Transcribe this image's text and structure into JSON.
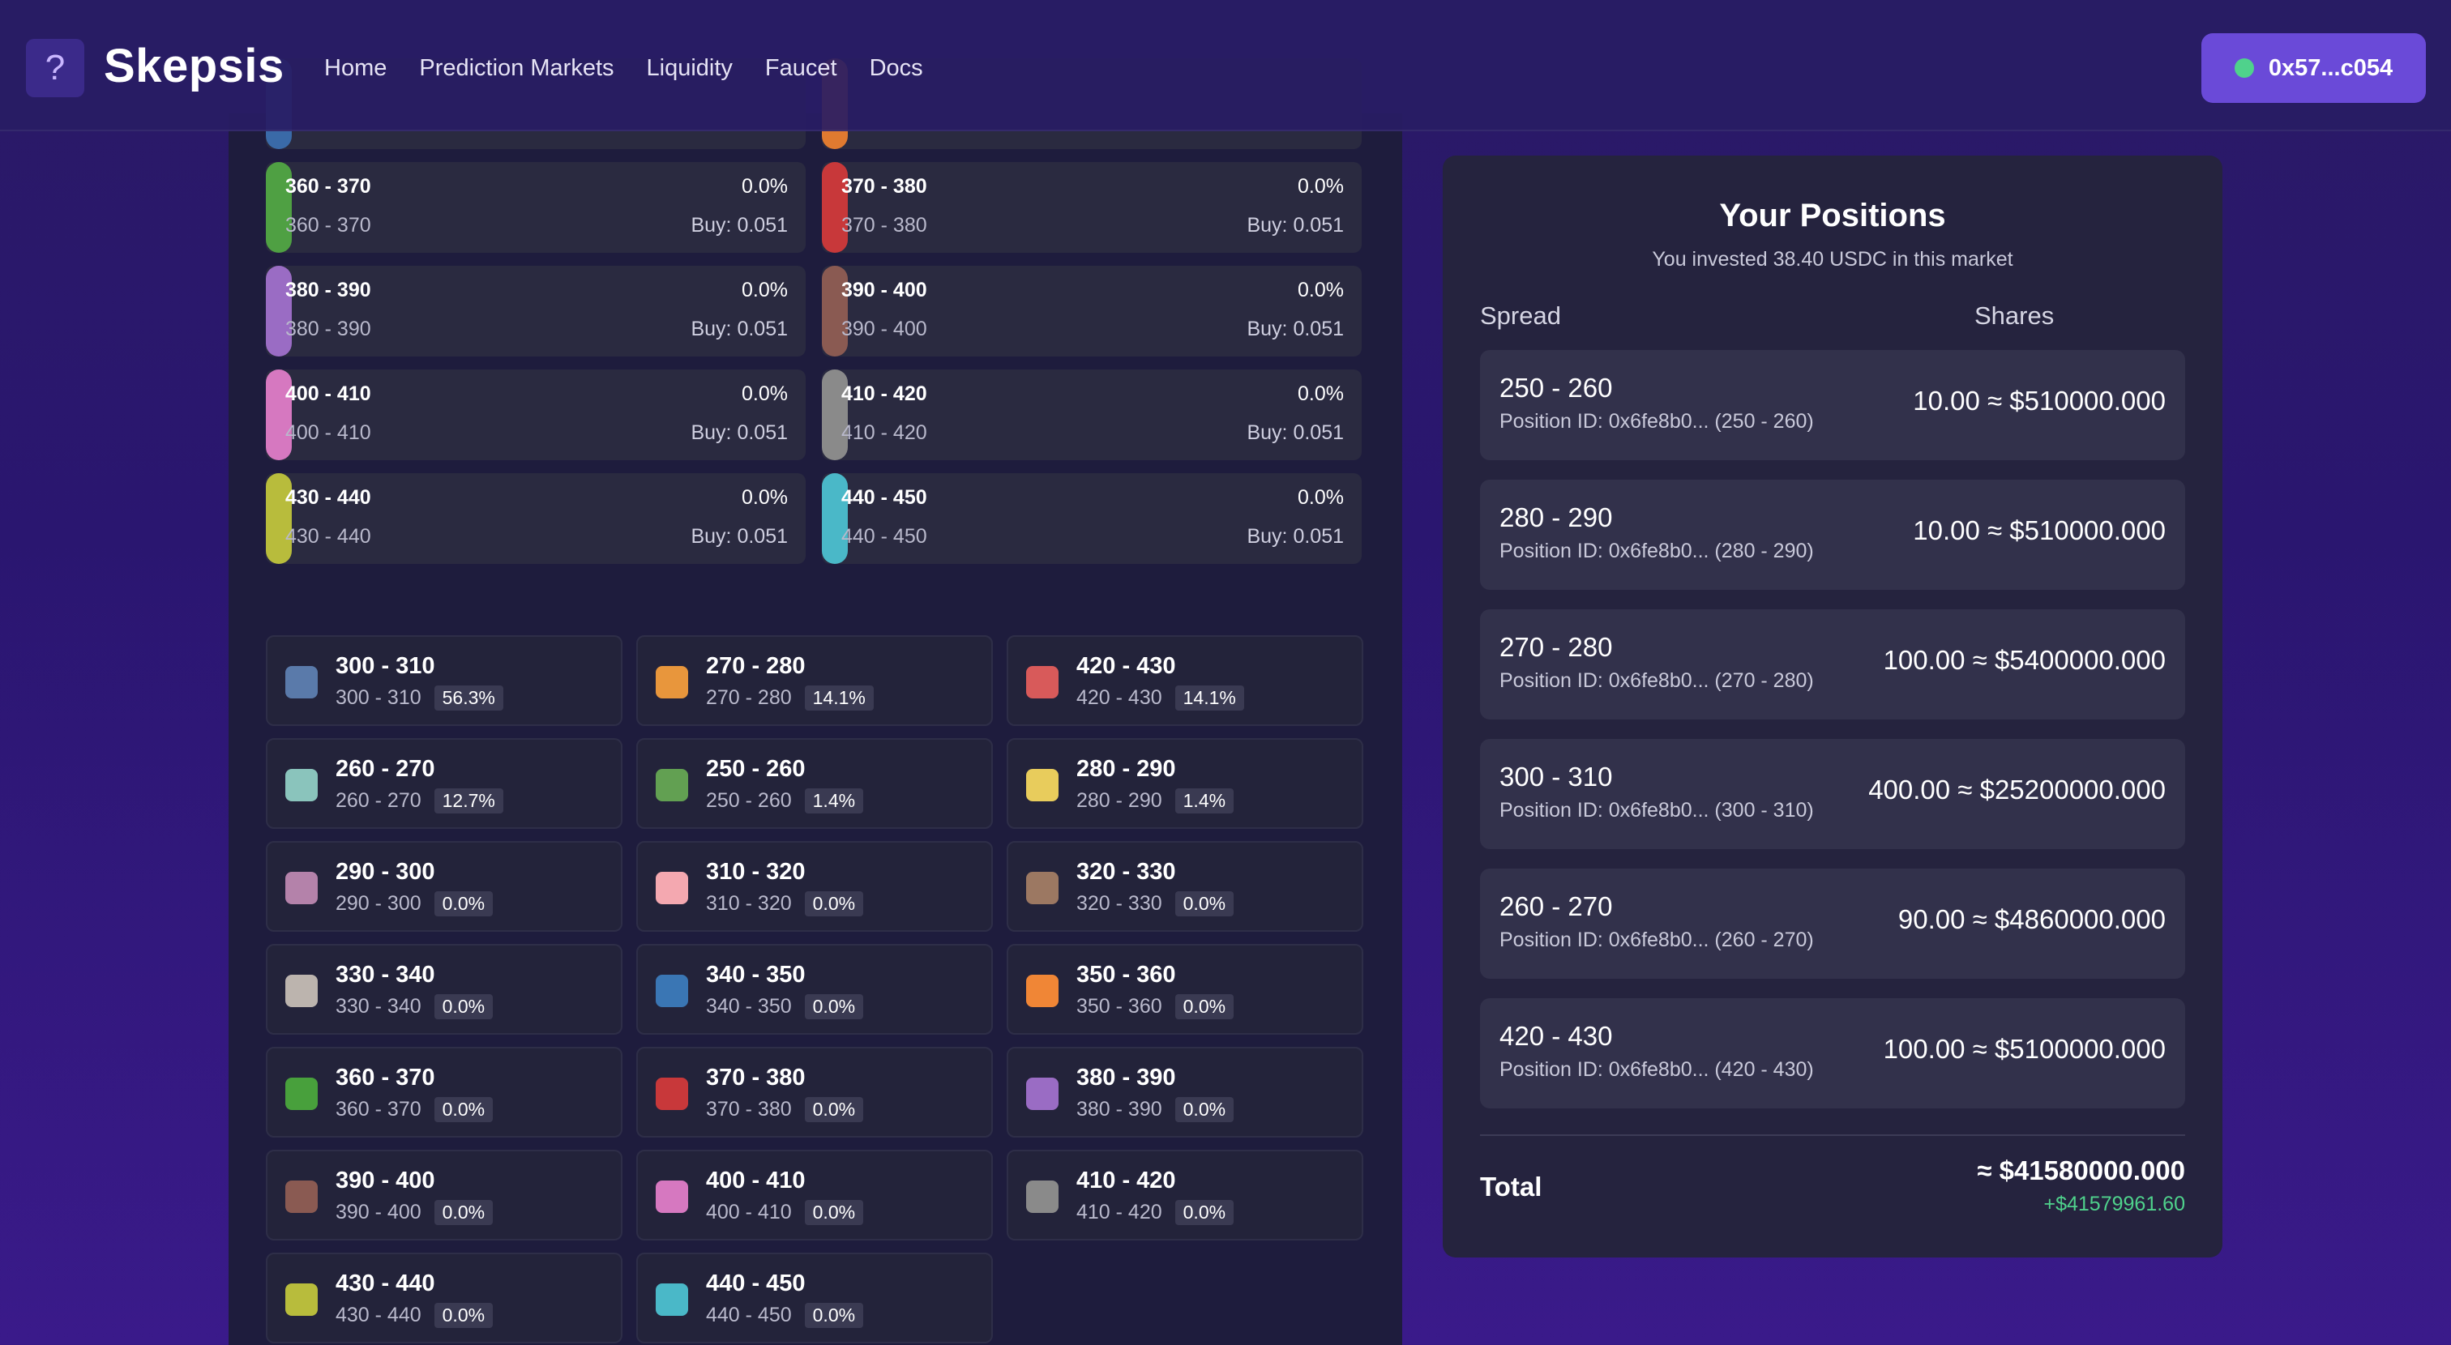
{
  "navbar": {
    "brand": "Skepsis",
    "logo_icon": "question-mark-icon",
    "links": [
      "Home",
      "Prediction Markets",
      "Liquidity",
      "Faucet",
      "Docs"
    ],
    "wallet": "0x57...c054",
    "wallet_status_color": "#4fd28c"
  },
  "outcomes": [
    {
      "title": "360 - 370",
      "sub": "360 - 370",
      "pct": "0.0%",
      "buy": "Buy: 0.051",
      "color": "#4fa043"
    },
    {
      "title": "370 - 380",
      "sub": "370 - 380",
      "pct": "0.0%",
      "buy": "Buy: 0.051",
      "color": "#c8383a"
    },
    {
      "title": "380 - 390",
      "sub": "380 - 390",
      "pct": "0.0%",
      "buy": "Buy: 0.051",
      "color": "#9a6cc4"
    },
    {
      "title": "390 - 400",
      "sub": "390 - 400",
      "pct": "0.0%",
      "buy": "Buy: 0.051",
      "color": "#8a5a52"
    },
    {
      "title": "400 - 410",
      "sub": "400 - 410",
      "pct": "0.0%",
      "buy": "Buy: 0.051",
      "color": "#d678c0"
    },
    {
      "title": "410 - 420",
      "sub": "410 - 420",
      "pct": "0.0%",
      "buy": "Buy: 0.051",
      "color": "#8a8a8a"
    },
    {
      "title": "430 - 440",
      "sub": "430 - 440",
      "pct": "0.0%",
      "buy": "Buy: 0.051",
      "color": "#b8bc3c"
    },
    {
      "title": "440 - 450",
      "sub": "440 - 450",
      "pct": "0.0%",
      "buy": "Buy: 0.051",
      "color": "#4ab8c8"
    }
  ],
  "legend": [
    {
      "title": "300 - 310",
      "sub": "300 - 310",
      "pct": "56.3%",
      "color": "#5a7aaa"
    },
    {
      "title": "270 - 280",
      "sub": "270 - 280",
      "pct": "14.1%",
      "color": "#e8963c"
    },
    {
      "title": "420 - 430",
      "sub": "420 - 430",
      "pct": "14.1%",
      "color": "#d85a5a"
    },
    {
      "title": "260 - 270",
      "sub": "260 - 270",
      "pct": "12.7%",
      "color": "#8ac4bc"
    },
    {
      "title": "250 - 260",
      "sub": "250 - 260",
      "pct": "1.4%",
      "color": "#62a052"
    },
    {
      "title": "280 - 290",
      "sub": "280 - 290",
      "pct": "1.4%",
      "color": "#e8cc5c"
    },
    {
      "title": "290 - 300",
      "sub": "290 - 300",
      "pct": "0.0%",
      "color": "#b482aa"
    },
    {
      "title": "310 - 320",
      "sub": "310 - 320",
      "pct": "0.0%",
      "color": "#f4a8b0"
    },
    {
      "title": "320 - 330",
      "sub": "320 - 330",
      "pct": "0.0%",
      "color": "#9c7862"
    },
    {
      "title": "330 - 340",
      "sub": "330 - 340",
      "pct": "0.0%",
      "color": "#bcb4ae"
    },
    {
      "title": "340 - 350",
      "sub": "340 - 350",
      "pct": "0.0%",
      "color": "#3a76b4"
    },
    {
      "title": "350 - 360",
      "sub": "350 - 360",
      "pct": "0.0%",
      "color": "#f08636"
    },
    {
      "title": "360 - 370",
      "sub": "360 - 370",
      "pct": "0.0%",
      "color": "#48a03c"
    },
    {
      "title": "370 - 380",
      "sub": "370 - 380",
      "pct": "0.0%",
      "color": "#c8383a"
    },
    {
      "title": "380 - 390",
      "sub": "380 - 390",
      "pct": "0.0%",
      "color": "#9a6cc4"
    },
    {
      "title": "390 - 400",
      "sub": "390 - 400",
      "pct": "0.0%",
      "color": "#8a5a52"
    },
    {
      "title": "400 - 410",
      "sub": "400 - 410",
      "pct": "0.0%",
      "color": "#d678c0"
    },
    {
      "title": "410 - 420",
      "sub": "410 - 420",
      "pct": "0.0%",
      "color": "#8a8a8a"
    },
    {
      "title": "430 - 440",
      "sub": "430 - 440",
      "pct": "0.0%",
      "color": "#b8bc3c"
    },
    {
      "title": "440 - 450",
      "sub": "440 - 450",
      "pct": "0.0%",
      "color": "#4ab8c8"
    }
  ],
  "positions_panel": {
    "title": "Your Positions",
    "subtitle": "You invested 38.40 USDC in this market",
    "col_spread": "Spread",
    "col_shares": "Shares",
    "positions": [
      {
        "spread": "250 - 260",
        "id": "Position ID: 0x6fe8b0... (250 - 260)",
        "value": "10.00  ≈ $510000.000"
      },
      {
        "spread": "280 - 290",
        "id": "Position ID: 0x6fe8b0... (280 - 290)",
        "value": "10.00  ≈ $510000.000"
      },
      {
        "spread": "270 - 280",
        "id": "Position ID: 0x6fe8b0... (270 - 280)",
        "value": "100.00  ≈ $5400000.000"
      },
      {
        "spread": "300 - 310",
        "id": "Position ID: 0x6fe8b0... (300 - 310)",
        "value": "400.00  ≈ $25200000.000"
      },
      {
        "spread": "260 - 270",
        "id": "Position ID: 0x6fe8b0... (260 - 270)",
        "value": "90.00  ≈ $4860000.000"
      },
      {
        "spread": "420 - 430",
        "id": "Position ID: 0x6fe8b0... (420 - 430)",
        "value": "100.00  ≈ $5100000.000"
      }
    ],
    "total_label": "Total",
    "total_value": "≈ $41580000.000",
    "total_gain": "+$41579961.60",
    "gain_color": "#4fd28c"
  }
}
